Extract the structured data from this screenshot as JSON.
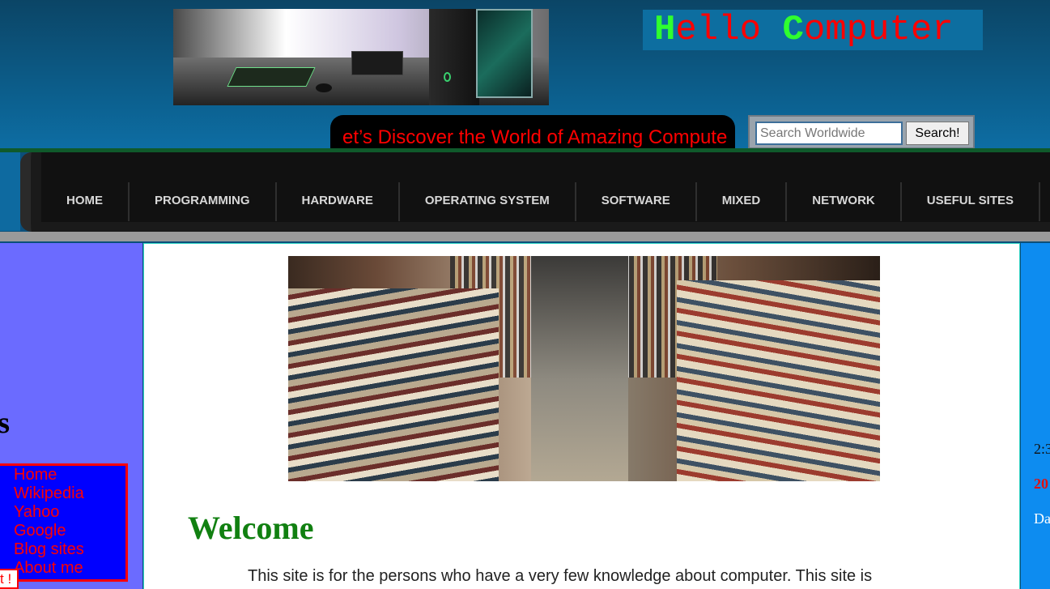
{
  "header": {
    "banner_image": "computer-desk-banner",
    "site_title": {
      "cap1": "H",
      "rest1": "ello ",
      "cap2": "C",
      "rest2": "omputer"
    },
    "marquee_text": "et’s Discover the World of Amazing Compute",
    "search": {
      "placeholder": "Search Worldwide",
      "button_label": "Search!"
    }
  },
  "nav": {
    "items": [
      "HOME",
      "PROGRAMMING",
      "HARDWARE",
      "OPERATING SYSTEM",
      "SOFTWARE",
      "MIXED",
      "NETWORK",
      "USEFUL SITES"
    ]
  },
  "left_sidebar": {
    "heading": "nks",
    "links": [
      "Home",
      "Wikipedia",
      "Yahoo",
      "Google",
      "Blog sites",
      "About me"
    ],
    "chat_tab": "t !"
  },
  "main": {
    "hero_image": "library-books-photo",
    "welcome_heading": "Welcome",
    "intro_text": "This site is for the persons who have a very few knowledge about computer. This site is"
  },
  "right_sidebar": {
    "time": "2:3",
    "year": "20",
    "day": "Da"
  },
  "colors": {
    "title_red": "#ff0000",
    "title_green": "#2fff2f",
    "left_sidebar_bg": "#6b6bff",
    "links_box_bg": "#0000ff",
    "right_sidebar_bg": "#0d8cf0",
    "welcome_green": "#118011"
  }
}
